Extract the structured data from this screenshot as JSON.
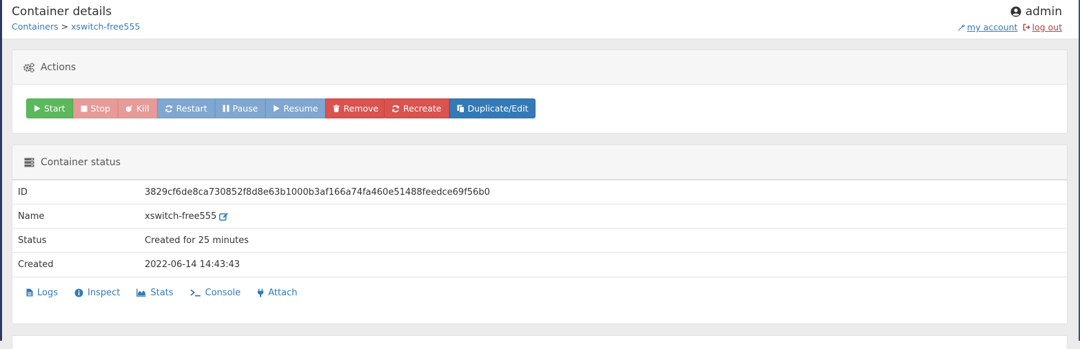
{
  "header": {
    "title": "Container details",
    "breadcrumb": {
      "root": "Containers",
      "separator": ">",
      "current": "xswitch-free555"
    },
    "user": {
      "name": "admin",
      "my_account": "my account",
      "logout": "log out"
    }
  },
  "actions": {
    "title": "Actions",
    "buttons": {
      "start": "Start",
      "stop": "Stop",
      "kill": "Kill",
      "restart": "Restart",
      "pause": "Pause",
      "resume": "Resume",
      "remove": "Remove",
      "recreate": "Recreate",
      "duplicate": "Duplicate/Edit"
    }
  },
  "status": {
    "title": "Container status",
    "rows": [
      {
        "key": "ID",
        "value": "3829cf6de8ca730852f8d8e63b1000b3af166a74fa460e51488feedce69f56b0"
      },
      {
        "key": "Name",
        "value": "xswitch-free555"
      },
      {
        "key": "Status",
        "value": "Created for 25 minutes"
      },
      {
        "key": "Created",
        "value": "2022-06-14 14:43:43"
      }
    ],
    "links": {
      "logs": "Logs",
      "inspect": "Inspect",
      "stats": "Stats",
      "console": "Console",
      "attach": "Attach"
    }
  },
  "colors": {
    "link": "#337ab7",
    "success": "#5cb85c",
    "danger": "#d9534f",
    "danger_disabled": "#e69b99",
    "primary": "#337ab7",
    "primary_disabled": "#7fa7cf"
  },
  "icons": {
    "user": "user-circle-icon",
    "account": "wrench-icon",
    "logout": "sign-out-icon",
    "actions": "cogs-icon",
    "status": "server-icon",
    "edit": "edit-icon",
    "logs": "file-icon",
    "inspect": "info-circle-icon",
    "stats": "area-chart-icon",
    "console": "terminal-icon",
    "attach": "plug-icon"
  }
}
